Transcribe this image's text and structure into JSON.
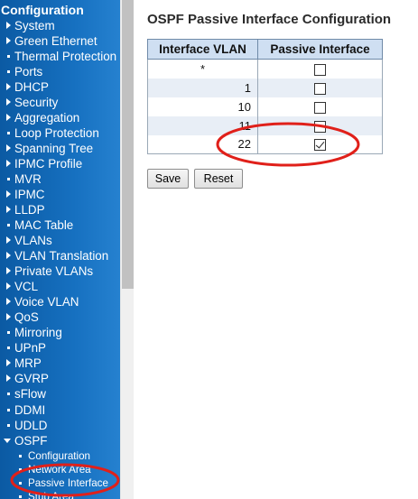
{
  "sidebar": {
    "heading": "Configuration",
    "items": [
      {
        "label": "System",
        "marker": "arrow-right"
      },
      {
        "label": "Green Ethernet",
        "marker": "arrow-right"
      },
      {
        "label": "Thermal Protection",
        "marker": "dot"
      },
      {
        "label": "Ports",
        "marker": "dot"
      },
      {
        "label": "DHCP",
        "marker": "arrow-right"
      },
      {
        "label": "Security",
        "marker": "arrow-right"
      },
      {
        "label": "Aggregation",
        "marker": "arrow-right"
      },
      {
        "label": "Loop Protection",
        "marker": "dot"
      },
      {
        "label": "Spanning Tree",
        "marker": "arrow-right"
      },
      {
        "label": "IPMC Profile",
        "marker": "arrow-right"
      },
      {
        "label": "MVR",
        "marker": "dot"
      },
      {
        "label": "IPMC",
        "marker": "arrow-right"
      },
      {
        "label": "LLDP",
        "marker": "arrow-right"
      },
      {
        "label": "MAC Table",
        "marker": "dot"
      },
      {
        "label": "VLANs",
        "marker": "arrow-right"
      },
      {
        "label": "VLAN Translation",
        "marker": "arrow-right"
      },
      {
        "label": "Private VLANs",
        "marker": "arrow-right"
      },
      {
        "label": "VCL",
        "marker": "arrow-right"
      },
      {
        "label": "Voice VLAN",
        "marker": "arrow-right"
      },
      {
        "label": "QoS",
        "marker": "arrow-right"
      },
      {
        "label": "Mirroring",
        "marker": "dot"
      },
      {
        "label": "UPnP",
        "marker": "dot"
      },
      {
        "label": "MRP",
        "marker": "arrow-right"
      },
      {
        "label": "GVRP",
        "marker": "arrow-right"
      },
      {
        "label": "sFlow",
        "marker": "dot"
      },
      {
        "label": "DDMI",
        "marker": "dot"
      },
      {
        "label": "UDLD",
        "marker": "dot"
      },
      {
        "label": "OSPF",
        "marker": "arrow-down"
      }
    ],
    "sub_items": [
      {
        "label": "Configuration"
      },
      {
        "label": "Network Area"
      },
      {
        "label": "Passive Interface"
      },
      {
        "label": "Stub Area"
      }
    ]
  },
  "page": {
    "title": "OSPF Passive Interface Configuration"
  },
  "table": {
    "headers": [
      "Interface VLAN",
      "Passive Interface"
    ],
    "rows": [
      {
        "vlan": "*",
        "checked": false
      },
      {
        "vlan": "1",
        "checked": false
      },
      {
        "vlan": "10",
        "checked": false
      },
      {
        "vlan": "11",
        "checked": false
      },
      {
        "vlan": "22",
        "checked": true
      }
    ]
  },
  "buttons": {
    "save": "Save",
    "reset": "Reset"
  },
  "annotation_color": "#e0201a"
}
